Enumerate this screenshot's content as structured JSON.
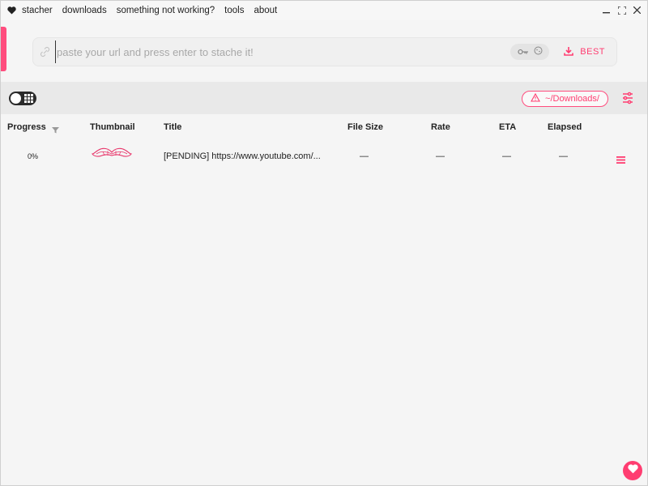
{
  "menu": {
    "items": [
      {
        "label": "stacher"
      },
      {
        "label": "downloads"
      },
      {
        "label": "something not working?"
      },
      {
        "label": "tools"
      },
      {
        "label": "about"
      }
    ]
  },
  "search": {
    "placeholder": "paste your url and press enter to stache it!",
    "value": "",
    "quality_label": "BEST"
  },
  "toolbar": {
    "download_folder": "~/Downloads/"
  },
  "table": {
    "columns": {
      "progress": "Progress",
      "thumbnail": "Thumbnail",
      "title": "Title",
      "file_size": "File Size",
      "rate": "Rate",
      "eta": "ETA",
      "elapsed": "Elapsed"
    },
    "rows": [
      {
        "progress": "0%",
        "title": "[PENDING] https://www.youtube.com/...",
        "file_size": "—",
        "rate": "—",
        "eta": "—",
        "elapsed": "—"
      }
    ]
  },
  "colors": {
    "accent": "#ff3d71",
    "background": "#f5f5f5",
    "toolbar": "#e9e9e9"
  },
  "icons": {
    "app": "heart-icon",
    "link": "link-icon",
    "key": "key-icon",
    "download": "download-icon",
    "warning": "warning-icon",
    "settings": "sliders-icon",
    "filter": "filter-icon",
    "thumbnail": "mustache-icon",
    "row_menu": "hamburger-icon",
    "fab": "heart-icon"
  }
}
